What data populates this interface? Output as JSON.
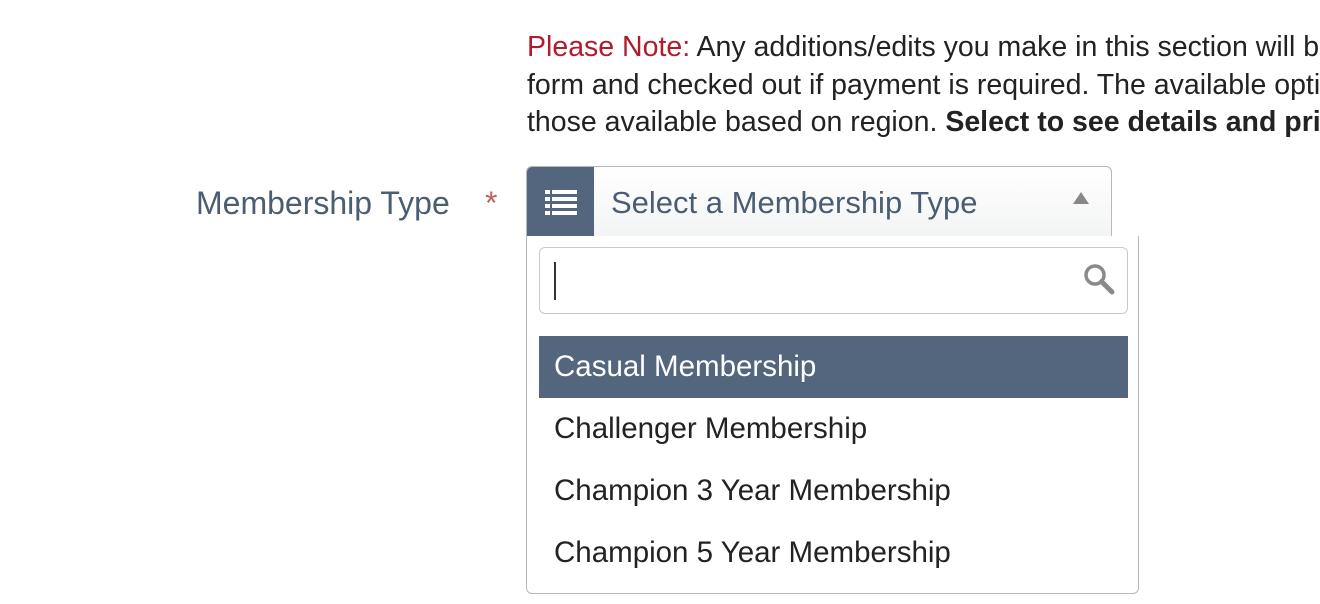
{
  "note": {
    "prefix": "Please Note:",
    "line1_text": " Any additions/edits you make in this section will be added to your",
    "line2_text": "form and checked out if payment is required. The available options are",
    "line3_text": "those available based on region. ",
    "line3_bold": "Select to see details and pricing."
  },
  "membership_field": {
    "label": "Membership Type",
    "required_marker": "*",
    "selected_placeholder": "Select a Membership Type",
    "icon": "list-icon",
    "arrow_icon": "caret-up-icon"
  },
  "dropdown": {
    "search": {
      "value": "",
      "placeholder": "",
      "icon": "search-icon"
    },
    "options": [
      "Casual Membership",
      "Challenger Membership",
      "Champion 3 Year Membership",
      "Champion 5 Year Membership"
    ],
    "highlighted_index": 0
  },
  "colors": {
    "accent_red": "#b01c2e",
    "label_slate": "#4b5d73",
    "highlight_bg": "#53667d",
    "required_red": "#c0605f"
  }
}
